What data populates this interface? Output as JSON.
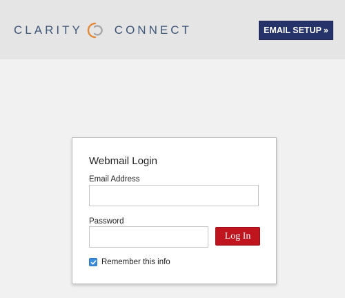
{
  "header": {
    "brand_left": "CLARITY",
    "brand_right": "CONNECT",
    "email_setup_label": "EMAIL SETUP",
    "email_setup_arrow": "»"
  },
  "login": {
    "title": "Webmail Login",
    "email_label": "Email Address",
    "email_value": "",
    "password_label": "Password",
    "password_value": "",
    "login_button": "Log In",
    "remember_label": "Remember this info",
    "remember_checked": true
  },
  "colors": {
    "brand_text": "#3e5678",
    "logo_orange": "#e28936",
    "logo_grey": "#a8a8a8",
    "setup_button_bg": "#26336a",
    "login_button_bg": "#c0141f",
    "checkbox_bg": "#3b8edb",
    "header_bg": "#e5e5e5",
    "page_bg": "#f1f1f1"
  },
  "icons": {
    "logo": "clarity-connect-logo-icon",
    "checkmark": "checkmark-icon"
  }
}
